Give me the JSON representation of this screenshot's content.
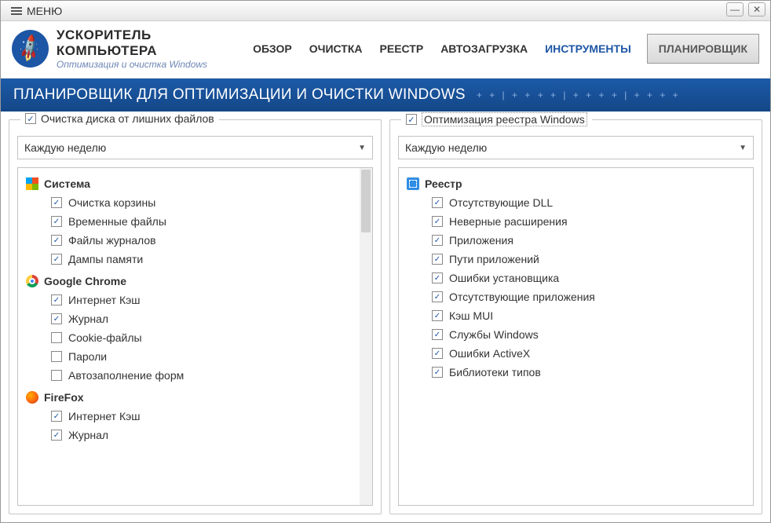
{
  "titlebar": {
    "menu_label": "МЕНЮ"
  },
  "brand": {
    "title": "УСКОРИТЕЛЬ КОМПЬЮТЕРА",
    "subtitle": "Оптимизация и очистка Windows"
  },
  "nav": {
    "items": [
      {
        "label": "ОБЗОР",
        "active": false
      },
      {
        "label": "ОЧИСТКА",
        "active": false
      },
      {
        "label": "РЕЕСТР",
        "active": false
      },
      {
        "label": "АВТОЗАГРУЗКА",
        "active": false
      },
      {
        "label": "ИНСТРУМЕНТЫ",
        "active": true
      }
    ],
    "button": "ПЛАНИРОВЩИК"
  },
  "banner": {
    "title": "ПЛАНИРОВЩИК ДЛЯ ОПТИМИЗАЦИИ И ОЧИСТКИ WINDOWS"
  },
  "panels": {
    "left": {
      "legend": "Очистка диска от лишних файлов",
      "legend_checked": true,
      "legend_selected": false,
      "dropdown": "Каждую неделю",
      "has_scrollbar": true,
      "groups": [
        {
          "icon": "windows",
          "title": "Система",
          "items": [
            {
              "label": "Очистка корзины",
              "checked": true
            },
            {
              "label": "Временные файлы",
              "checked": true
            },
            {
              "label": "Файлы журналов",
              "checked": true
            },
            {
              "label": "Дампы памяти",
              "checked": true
            }
          ]
        },
        {
          "icon": "chrome",
          "title": "Google Chrome",
          "items": [
            {
              "label": "Интернет Кэш",
              "checked": true
            },
            {
              "label": "Журнал",
              "checked": true
            },
            {
              "label": "Cookie-файлы",
              "checked": false
            },
            {
              "label": "Пароли",
              "checked": false
            },
            {
              "label": "Автозаполнение форм",
              "checked": false
            }
          ]
        },
        {
          "icon": "firefox",
          "title": "FireFox",
          "items": [
            {
              "label": "Интернет Кэш",
              "checked": true
            },
            {
              "label": "Журнал",
              "checked": true
            }
          ]
        }
      ]
    },
    "right": {
      "legend": "Оптимизация реестра Windows",
      "legend_checked": true,
      "legend_selected": true,
      "dropdown": "Каждую неделю",
      "has_scrollbar": false,
      "groups": [
        {
          "icon": "registry",
          "title": "Реестр",
          "items": [
            {
              "label": "Отсутствующие DLL",
              "checked": true
            },
            {
              "label": "Неверные расширения",
              "checked": true
            },
            {
              "label": "Приложения",
              "checked": true
            },
            {
              "label": "Пути приложений",
              "checked": true
            },
            {
              "label": "Ошибки установщика",
              "checked": true
            },
            {
              "label": "Отсутствующие приложения",
              "checked": true
            },
            {
              "label": "Кэш MUI",
              "checked": true
            },
            {
              "label": "Службы Windows",
              "checked": true
            },
            {
              "label": "Ошибки ActiveX",
              "checked": true
            },
            {
              "label": "Библиотеки типов",
              "checked": true
            }
          ]
        }
      ]
    }
  }
}
